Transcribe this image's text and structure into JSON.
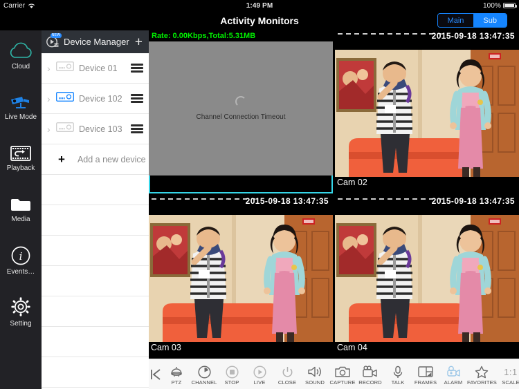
{
  "statusbar": {
    "carrier": "Carrier",
    "time": "1:49 PM",
    "battery": "100%",
    "wifi_icon": "wifi-icon",
    "battery_icon": "battery-icon"
  },
  "navbar": {
    "title": "Activity Monitors",
    "stream_toggle": [
      {
        "label": "Main",
        "selected": false
      },
      {
        "label": "Sub",
        "selected": true
      }
    ]
  },
  "sidebar": {
    "items": [
      {
        "label": "Cloud",
        "icon": "cloud-icon",
        "color": "#2fb6a8"
      },
      {
        "label": "Live Mode",
        "icon": "camera-icon",
        "color": "#1e82e6"
      },
      {
        "label": "Playback",
        "icon": "playback-icon",
        "color": "#ffffff"
      },
      {
        "label": "Media",
        "icon": "folder-icon",
        "color": "#ffffff"
      },
      {
        "label": "Events…",
        "icon": "info-icon",
        "color": "#ffffff"
      },
      {
        "label": "Setting",
        "icon": "gear-icon",
        "color": "#ffffff"
      }
    ]
  },
  "device_manager": {
    "title": "Device Manager",
    "header_icon": "device-manager-icon",
    "badge": "NEW",
    "add_icon": "plus-icon",
    "devices": [
      {
        "name": "Device 01",
        "online": false,
        "chevron": "chevron-right-icon",
        "menu": "hamburger-icon"
      },
      {
        "name": "Device 102",
        "online": true,
        "chevron": "chevron-right-icon",
        "menu": "hamburger-icon"
      },
      {
        "name": "Device 103",
        "online": false,
        "chevron": "chevron-right-icon",
        "menu": "hamburger-icon"
      }
    ],
    "add_device_label": "Add a new device",
    "empty_row_count": 7
  },
  "video_grid": {
    "selection_color": "#35d6e8",
    "cells": [
      {
        "id": "cell-1",
        "label": "",
        "selected": true,
        "state": "timeout",
        "rate_text": "Rate: 0.00Kbps,Total:5.31MB",
        "timeout_text": "Channel Connection Timeout",
        "timestamp": ""
      },
      {
        "id": "cell-2",
        "label": "Cam 02",
        "selected": false,
        "state": "live",
        "rate_text": "",
        "timeout_text": "",
        "timestamp": "2015-09-18  13:47:35"
      },
      {
        "id": "cell-3",
        "label": "Cam 03",
        "selected": false,
        "state": "live",
        "rate_text": "",
        "timeout_text": "",
        "timestamp": "2015-09-18  13:47:35"
      },
      {
        "id": "cell-4",
        "label": "Cam 04",
        "selected": false,
        "state": "live",
        "rate_text": "",
        "timeout_text": "",
        "timestamp": "2015-09-18  13:47:35"
      }
    ]
  },
  "toolbar": {
    "back_icon": "back-to-start-icon",
    "items": [
      {
        "label": "PTZ",
        "icon": "ptz-icon",
        "active": false
      },
      {
        "label": "CHANNEL",
        "icon": "channel-icon",
        "active": false
      },
      {
        "label": "STOP",
        "icon": "stop-icon",
        "active": false
      },
      {
        "label": "LIVE",
        "icon": "play-icon",
        "active": false
      },
      {
        "label": "CLOSE",
        "icon": "power-icon",
        "active": false
      },
      {
        "label": "SOUND",
        "icon": "sound-icon",
        "active": false
      },
      {
        "label": "CAPTURE",
        "icon": "camera-icon",
        "active": false
      },
      {
        "label": "RECORD",
        "icon": "video-icon",
        "active": false
      },
      {
        "label": "TALK",
        "icon": "microphone-icon",
        "active": false
      },
      {
        "label": "FRAMES",
        "icon": "frames-icon",
        "active": false
      },
      {
        "label": "ALARM",
        "icon": "alarm-icon",
        "active": true
      },
      {
        "label": "FAVORITES",
        "icon": "star-icon",
        "active": false
      },
      {
        "label": "SCALE",
        "icon": "scale-icon",
        "active": false,
        "value": "1:1"
      }
    ]
  }
}
